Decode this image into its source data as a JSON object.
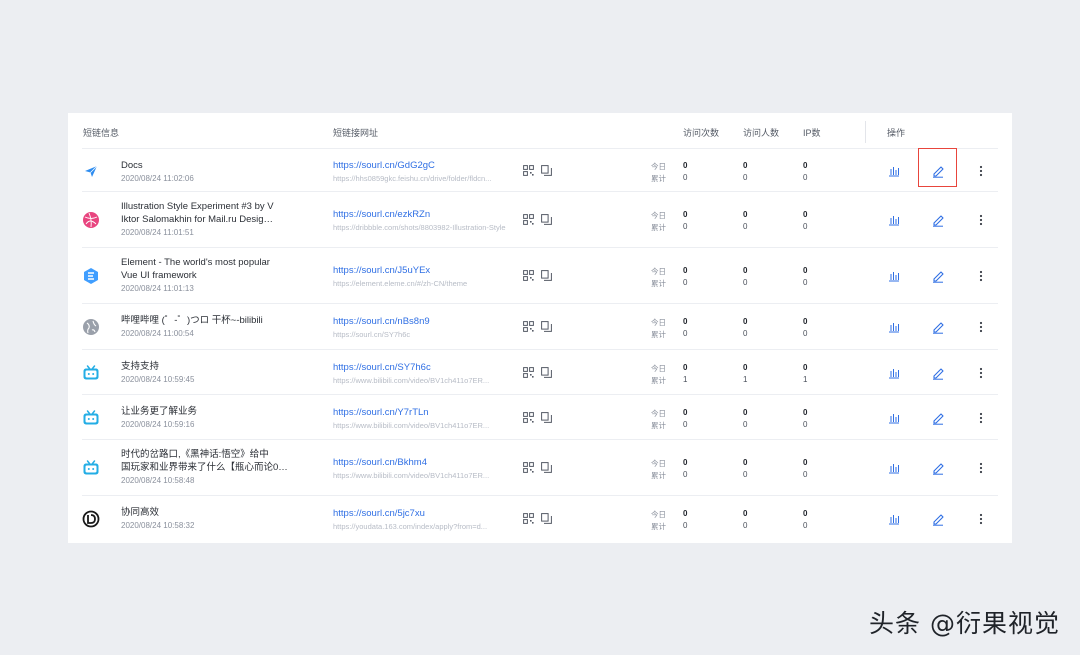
{
  "header": {
    "col_info": "短链信息",
    "col_url": "短链接网址",
    "col_visits": "访问次数",
    "col_visitors": "访问人数",
    "col_ip": "IP数",
    "col_ops": "操作"
  },
  "labels": {
    "today": "今日",
    "total": "累计"
  },
  "rows": [
    {
      "icon": "paper-plane-icon",
      "title": "Docs",
      "date": "2020/08/24 11:02:06",
      "short_url": "https://sourl.cn/GdG2gC",
      "long_url": "https://hhs0859gkc.feishu.cn/drive/folder/fldcn...",
      "visits_today": "0",
      "visits_total": "0",
      "visitors_today": "0",
      "visitors_total": "0",
      "ip_today": "0",
      "ip_total": "0"
    },
    {
      "icon": "dribbble-icon",
      "title": "Illustration Style Experiment #3 by V\nIktor Salomakhin for Mail.ru Desig…",
      "date": "2020/08/24 11:01:51",
      "short_url": "https://sourl.cn/ezkRZn",
      "long_url": "https://dribbble.com/shots/8803982-Illustration-Style",
      "visits_today": "0",
      "visits_total": "0",
      "visitors_today": "0",
      "visitors_total": "0",
      "ip_today": "0",
      "ip_total": "0"
    },
    {
      "icon": "element-logo-icon",
      "title": "Element - The world's most popular\nVue UI framework",
      "date": "2020/08/24 11:01:13",
      "short_url": "https://sourl.cn/J5uYEx",
      "long_url": "https://element.eleme.cn/#/zh-CN/theme",
      "visits_today": "0",
      "visits_total": "0",
      "visitors_today": "0",
      "visitors_total": "0",
      "ip_today": "0",
      "ip_total": "0"
    },
    {
      "icon": "globe-icon",
      "title": "哔哩哔哩 (゜-゜)つロ 干杯~-bilibili",
      "date": "2020/08/24 11:00:54",
      "short_url": "https://sourl.cn/nBs8n9",
      "long_url": "https://sourl.cn/SY7h6c",
      "visits_today": "0",
      "visits_total": "0",
      "visitors_today": "0",
      "visitors_total": "0",
      "ip_today": "0",
      "ip_total": "0"
    },
    {
      "icon": "bilibili-tv-icon",
      "title": "支持支持",
      "date": "2020/08/24 10:59:45",
      "short_url": "https://sourl.cn/SY7h6c",
      "long_url": "https://www.bilibili.com/video/BV1ch411o7ER...",
      "visits_today": "0",
      "visits_total": "1",
      "visitors_today": "0",
      "visitors_total": "1",
      "ip_today": "0",
      "ip_total": "1"
    },
    {
      "icon": "bilibili-tv-icon",
      "title": "让业务更了解业务",
      "date": "2020/08/24 10:59:16",
      "short_url": "https://sourl.cn/Y7rTLn",
      "long_url": "https://www.bilibili.com/video/BV1ch411o7ER...",
      "visits_today": "0",
      "visits_total": "0",
      "visitors_today": "0",
      "visitors_total": "0",
      "ip_today": "0",
      "ip_total": "0"
    },
    {
      "icon": "bilibili-tv-icon",
      "title": "时代的岔路口,《黑神话:悟空》给中\n国玩家和业界带来了什么【瓶心而论0…",
      "date": "2020/08/24 10:58:48",
      "short_url": "https://sourl.cn/Bkhm4",
      "long_url": "https://www.bilibili.com/video/BV1ch411o7ER...",
      "visits_today": "0",
      "visits_total": "0",
      "visitors_today": "0",
      "visitors_total": "0",
      "ip_today": "0",
      "ip_total": "0"
    },
    {
      "icon": "youdao-logo-icon",
      "title": "协同高效",
      "date": "2020/08/24 10:58:32",
      "short_url": "https://sourl.cn/5jc7xu",
      "long_url": "https://youdata.163.com/index/apply?from=d...",
      "visits_today": "0",
      "visits_total": "0",
      "visitors_today": "0",
      "visitors_total": "0",
      "ip_today": "0",
      "ip_total": "0"
    }
  ],
  "watermark": "头条 @衍果视觉",
  "colors": {
    "link": "#2f6fe4",
    "highlight": "#e8453c",
    "bilibili": "#23ade5"
  }
}
